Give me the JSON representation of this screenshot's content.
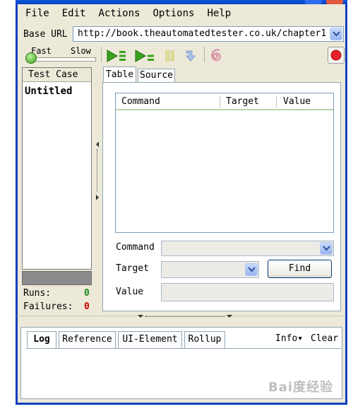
{
  "menu": {
    "file": "File",
    "edit": "Edit",
    "actions": "Actions",
    "options": "Options",
    "help": "Help"
  },
  "base_url": {
    "label": "Base URL",
    "value": "http://book.theautomatedtester.co.uk/chapter1"
  },
  "speed": {
    "fast": "Fast",
    "slow": "Slow"
  },
  "test_case_panel": {
    "header": "Test Case",
    "items": [
      "Untitled"
    ]
  },
  "stats": {
    "runs_label": "Runs:",
    "runs_value": "0",
    "failures_label": "Failures:",
    "failures_value": "0"
  },
  "editor_tabs": {
    "table": "Table",
    "source": "Source"
  },
  "command_table": {
    "columns": [
      "Command",
      "Target",
      "Value"
    ]
  },
  "fields": {
    "command_label": "Command",
    "target_label": "Target",
    "value_label": "Value",
    "find_button": "Find"
  },
  "bottom_tabs": {
    "log": "Log",
    "reference": "Reference",
    "ui_element": "UI-Element",
    "rollup": "Rollup",
    "info": "Info▾",
    "clear": "Clear"
  },
  "colors": {
    "window_border": "#0a3fbf",
    "play_green": "#3aa11c",
    "record_red": "#e8222a",
    "failure_red": "#cc0000",
    "runs_green": "#1a8a1a"
  },
  "watermark": "Bai度经验"
}
